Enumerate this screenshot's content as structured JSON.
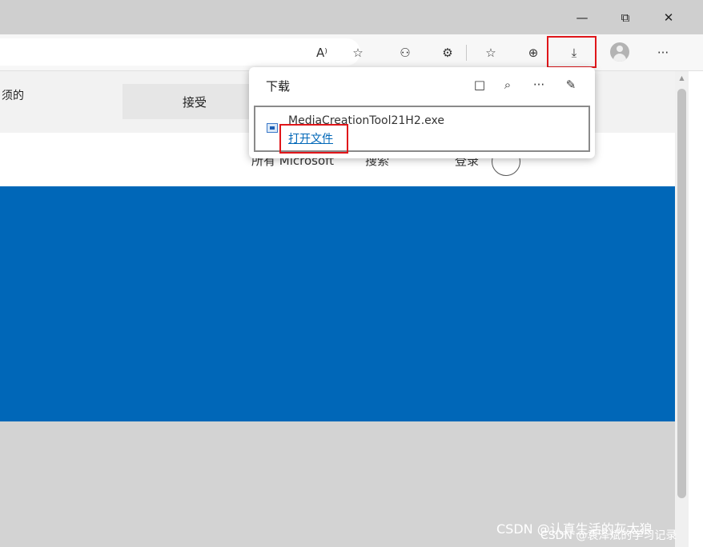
{
  "window": {
    "minimize_icon": "minimize-icon",
    "restore_icon": "restore-icon",
    "close_icon": "close-icon",
    "minimize_glyph": "—",
    "restore_glyph": "⧉",
    "close_glyph": "✕"
  },
  "toolbar": {
    "read_aloud_glyph": "A⁾",
    "favorite_add_glyph": "☆",
    "performance_glyph": "⚇",
    "extensions_glyph": "⚙",
    "favorites_glyph": "☆",
    "collections_glyph": "⊕",
    "downloads_glyph": "⤓",
    "more_glyph": "···"
  },
  "cookie_bar": {
    "text": "须的",
    "accept_label": "接受"
  },
  "site_nav": {
    "all_microsoft": "所有 Microsoft",
    "search": "搜索",
    "sign_in": "登录"
  },
  "downloads_panel": {
    "title": "下载",
    "folder_glyph": "□",
    "search_glyph": "⌕",
    "more_glyph": "···",
    "pin_glyph": "✎",
    "item": {
      "file_name": "MediaCreationTool21H2.exe",
      "open_file_label": "打开文件"
    }
  },
  "watermarks": {
    "line1": "CSDN @认真生活的灰太狼",
    "line2": "CSDN @袁泽斌的学习记录"
  },
  "colors": {
    "highlight": "#e0161a",
    "hero": "#0067b8",
    "link": "#0067b8"
  }
}
